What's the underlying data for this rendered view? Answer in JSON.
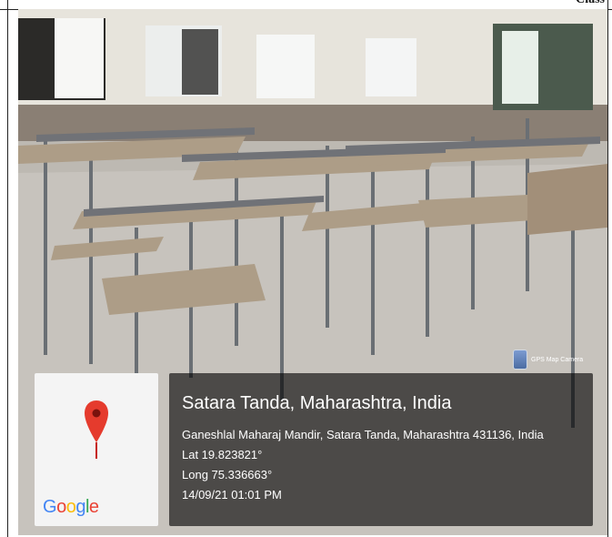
{
  "header": {
    "label": "Class"
  },
  "map_card": {
    "pin_icon": "map-pin-icon",
    "logo": "Google",
    "logo_colors": [
      "#4285F4",
      "#EA4335",
      "#FBBC05",
      "#4285F4",
      "#34A853",
      "#EA4335"
    ]
  },
  "info_card": {
    "title": "Satara Tanda, Maharashtra, India",
    "address": "Ganeshlal Maharaj Mandir, Satara Tanda, Maharashtra 431136, India",
    "lat": "Lat 19.823821°",
    "long": "Long 75.336663°",
    "datetime": "14/09/21 01:01 PM"
  },
  "badge": {
    "icon": "gps-map-camera-icon",
    "label": "GPS Map Camera"
  }
}
